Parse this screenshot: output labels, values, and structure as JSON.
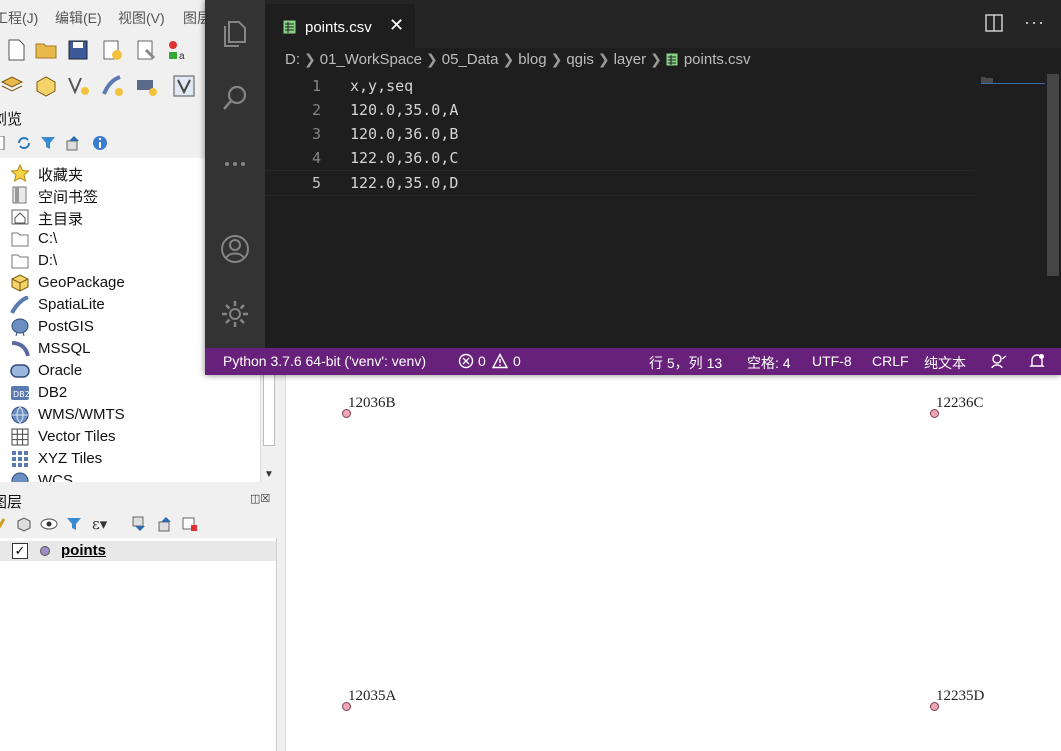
{
  "qgis": {
    "menu": [
      "工程(J)",
      "编辑(E)",
      "视图(V)",
      "图层"
    ],
    "browser_panel": {
      "title": "浏览",
      "items": [
        {
          "label": "收藏夹",
          "icon": "star-icon"
        },
        {
          "label": "空间书签",
          "icon": "bookmark-icon"
        },
        {
          "label": "主目录",
          "icon": "home-icon"
        },
        {
          "label": "C:\\",
          "icon": "folder-icon"
        },
        {
          "label": "D:\\",
          "icon": "folder-icon"
        },
        {
          "label": "GeoPackage",
          "icon": "geopackage-icon"
        },
        {
          "label": "SpatiaLite",
          "icon": "spatialite-icon"
        },
        {
          "label": "PostGIS",
          "icon": "postgis-icon"
        },
        {
          "label": "MSSQL",
          "icon": "mssql-icon"
        },
        {
          "label": "Oracle",
          "icon": "oracle-icon"
        },
        {
          "label": "DB2",
          "icon": "db2-icon"
        },
        {
          "label": "WMS/WMTS",
          "icon": "globe-icon"
        },
        {
          "label": "Vector Tiles",
          "icon": "grid-icon"
        },
        {
          "label": "XYZ Tiles",
          "icon": "tiles-icon"
        },
        {
          "label": "WCS",
          "icon": "globe-icon"
        }
      ],
      "db2_badge": "DB2"
    },
    "layers_panel": {
      "title": "图层",
      "layers": [
        {
          "name": "points",
          "checked": true,
          "symbol_color": "#a08cc8"
        }
      ]
    },
    "map": {
      "point_color": "#f2a5b5",
      "labels": [
        {
          "text": "12036B"
        },
        {
          "text": "12236C"
        },
        {
          "text": "12035A"
        },
        {
          "text": "12235D"
        }
      ]
    }
  },
  "vscode": {
    "tab": {
      "title": "points.csv",
      "close": "✕"
    },
    "breadcrumb": [
      "D:",
      "01_WorkSpace",
      "05_Data",
      "blog",
      "qgis",
      "layer",
      "points.csv"
    ],
    "lines": [
      {
        "no": "1",
        "text": "x,y,seq"
      },
      {
        "no": "2",
        "text": "120.0,35.0,A"
      },
      {
        "no": "3",
        "text": "120.0,36.0,B"
      },
      {
        "no": "4",
        "text": "122.0,36.0,C"
      },
      {
        "no": "5",
        "text": "122.0,35.0,D"
      }
    ],
    "status": {
      "interpreter": "Python 3.7.6 64-bit ('venv': venv)",
      "errors": "0",
      "warnings": "0",
      "cursor": "行 5，列 13",
      "indent": "空格: 4",
      "encoding": "UTF-8",
      "eol": "CRLF",
      "language": "纯文本"
    },
    "colors": {
      "status_bar": "#68217a",
      "activity_bar": "#333333",
      "editor_bg": "#1e1e1e",
      "csv_icon": "#89d185"
    }
  }
}
